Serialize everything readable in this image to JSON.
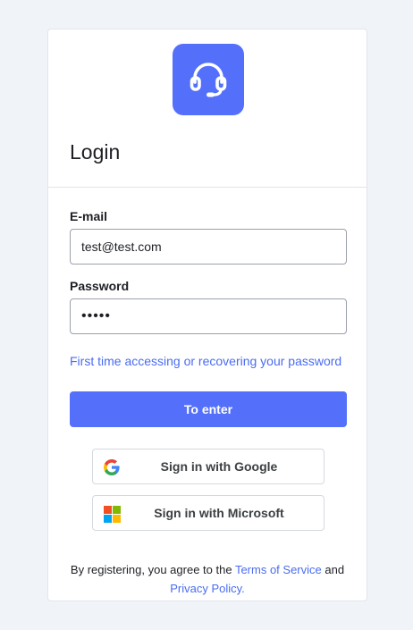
{
  "header": {
    "title": "Login",
    "logo_icon": "headset-icon",
    "logo_color": "#5470fb"
  },
  "form": {
    "email_label": "E-mail",
    "email_value": "test@test.com",
    "password_label": "Password",
    "password_value": "•••••",
    "recover_link": "First time accessing or recovering your password",
    "submit_label": "To enter"
  },
  "sso": {
    "google_label": "Sign in with Google",
    "microsoft_label": "Sign in with Microsoft"
  },
  "footer": {
    "terms_prefix": "By registering, you agree to the ",
    "terms_link": "Terms of Service",
    "terms_and": " and",
    "privacy_link": "Privacy Policy."
  },
  "colors": {
    "accent": "#5470fb",
    "link": "#4a6cf0",
    "background": "#f0f3f8"
  }
}
